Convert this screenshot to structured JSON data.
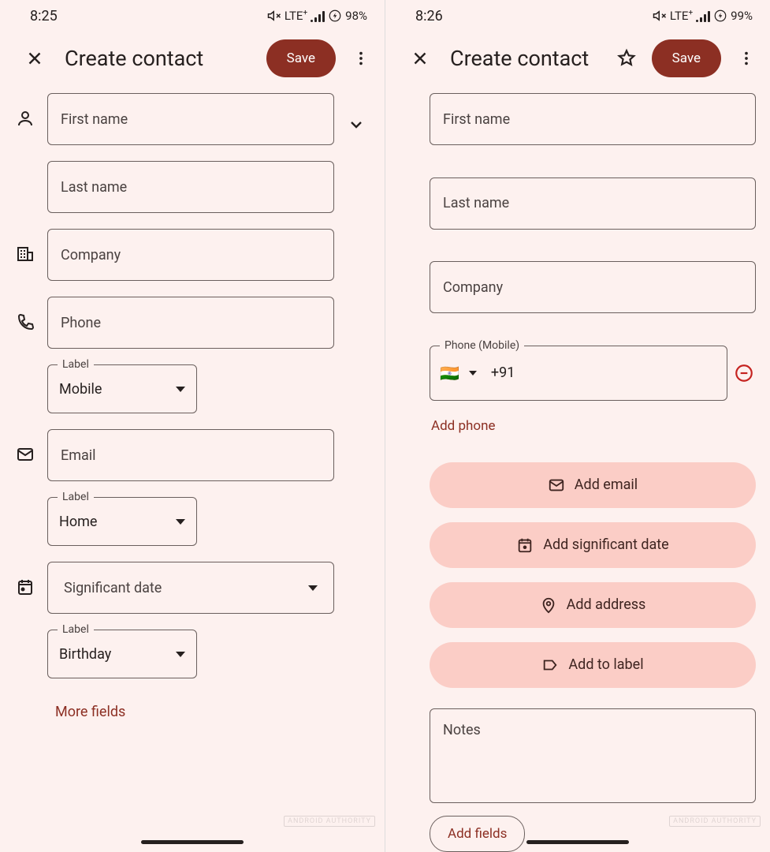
{
  "left": {
    "status": {
      "time": "8:25",
      "net": "LTE",
      "netplus": "+",
      "battery": "98%"
    },
    "header": {
      "title": "Create contact",
      "save": "Save"
    },
    "first_name": "First name",
    "last_name": "Last name",
    "company": "Company",
    "phone": "Phone",
    "label_caption": "Label",
    "phone_label_value": "Mobile",
    "email": "Email",
    "email_label_value": "Home",
    "sigdate": "Significant date",
    "sigdate_label_value": "Birthday",
    "more_fields": "More fields"
  },
  "right": {
    "status": {
      "time": "8:26",
      "net": "LTE",
      "netplus": "+",
      "battery": "99%"
    },
    "header": {
      "title": "Create contact",
      "save": "Save"
    },
    "first_name": "First name",
    "last_name": "Last name",
    "company": "Company",
    "phone_float": "Phone (Mobile)",
    "phone_flag": "🇮🇳",
    "phone_cc": "+91",
    "add_phone": "Add phone",
    "chips": {
      "email": "Add email",
      "date": "Add significant date",
      "address": "Add address",
      "label": "Add to label"
    },
    "notes": "Notes",
    "add_fields": "Add fields"
  },
  "watermark": "ANDROID AUTHORITY"
}
